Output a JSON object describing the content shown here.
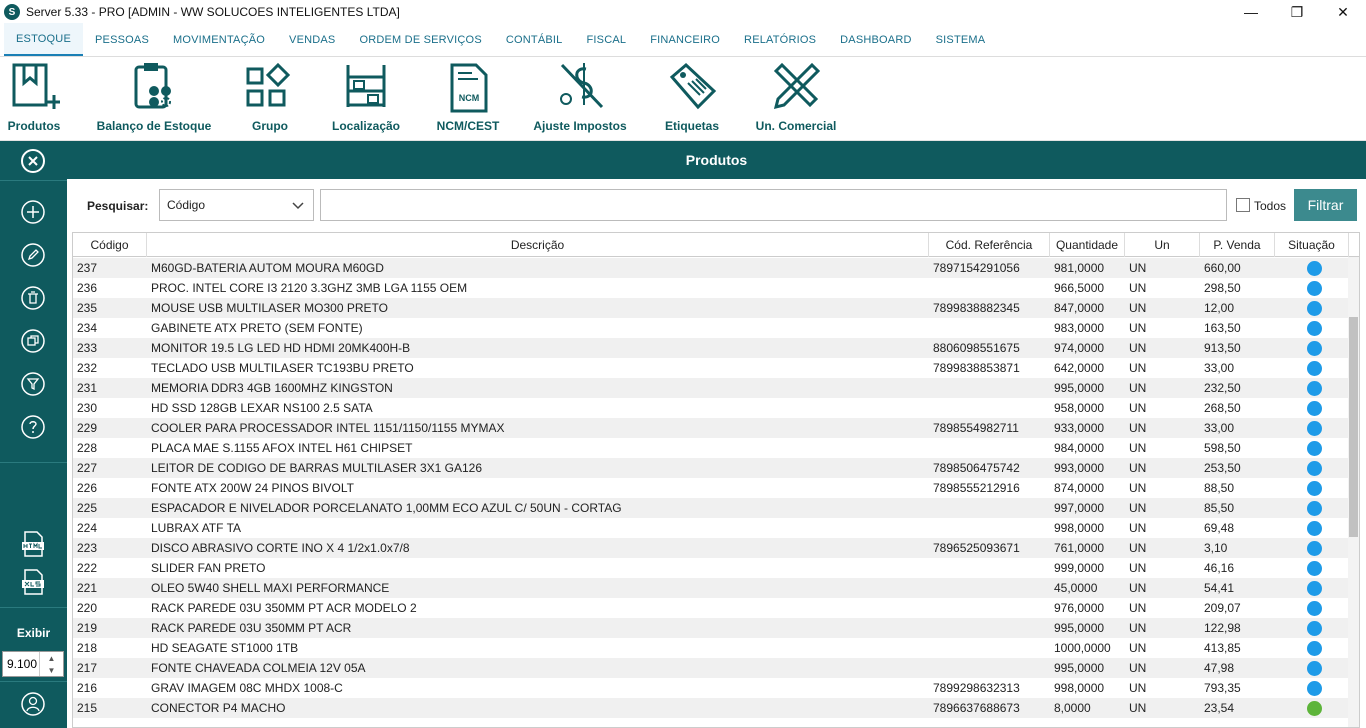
{
  "window": {
    "title": "Server 5.33 - PRO [ADMIN - WW SOLUCOES INTELIGENTES LTDA]",
    "logo_text": "S",
    "minimize": "—",
    "maximize": "❐",
    "close": "✕"
  },
  "menu": [
    "ESTOQUE",
    "PESSOAS",
    "MOVIMENTAÇÃO",
    "VENDAS",
    "ORDEM DE SERVIÇOS",
    "CONTÁBIL",
    "FISCAL",
    "FINANCEIRO",
    "RELATÓRIOS",
    "DASHBOARD",
    "SISTEMA"
  ],
  "ribbon": [
    "Produtos",
    "Balanço de Estoque",
    "Grupo",
    "Localização",
    "NCM/CEST",
    "Ajuste Impostos",
    "Etiquetas",
    "Un. Comercial"
  ],
  "ncm_icon_text": "NCM",
  "sidebar": {
    "exibir_label": "Exibir",
    "page_size": "9.100"
  },
  "page_title": "Produtos",
  "search": {
    "label": "Pesquisar:",
    "field": "Código",
    "query": "",
    "todos_label": "Todos",
    "filter_label": "Filtrar"
  },
  "colors": {
    "primary": "#0f5a5e",
    "accent_link": "#1a6f8a",
    "status_active": "#1e9be8",
    "status_other": "#5db43a"
  },
  "columns": [
    "Código",
    "Descrição",
    "Cód. Referência",
    "Quantidade",
    "Un",
    "P. Venda",
    "Situação"
  ],
  "rows": [
    [
      "237",
      "M60GD-BATERIA AUTOM MOURA M60GD",
      "7897154291056",
      "981,0000",
      "UN",
      "660,00",
      "blue"
    ],
    [
      "236",
      "PROC. INTEL CORE I3 2120 3.3GHZ 3MB LGA 1155 OEM",
      "",
      "966,5000",
      "UN",
      "298,50",
      "blue"
    ],
    [
      "235",
      "MOUSE USB MULTILASER MO300 PRETO",
      "7899838882345",
      "847,0000",
      "UN",
      "12,00",
      "blue"
    ],
    [
      "234",
      "GABINETE ATX PRETO (SEM FONTE)",
      "",
      "983,0000",
      "UN",
      "163,50",
      "blue"
    ],
    [
      "233",
      "MONITOR 19.5 LG LED HD HDMI 20MK400H-B",
      "8806098551675",
      "974,0000",
      "UN",
      "913,50",
      "blue"
    ],
    [
      "232",
      "TECLADO USB MULTILASER TC193BU PRETO",
      "7899838853871",
      "642,0000",
      "UN",
      "33,00",
      "blue"
    ],
    [
      "231",
      "MEMORIA DDR3 4GB 1600MHZ KINGSTON",
      "",
      "995,0000",
      "UN",
      "232,50",
      "blue"
    ],
    [
      "230",
      "HD SSD 128GB LEXAR NS100 2.5 SATA",
      "",
      "958,0000",
      "UN",
      "268,50",
      "blue"
    ],
    [
      "229",
      "COOLER PARA PROCESSADOR INTEL 1151/1150/1155 MYMAX",
      "7898554982711",
      "933,0000",
      "UN",
      "33,00",
      "blue"
    ],
    [
      "228",
      "PLACA MAE S.1155 AFOX INTEL H61 CHIPSET",
      "",
      "984,0000",
      "UN",
      "598,50",
      "blue"
    ],
    [
      "227",
      "LEITOR DE CODIGO DE BARRAS MULTILASER 3X1 GA126",
      "7898506475742",
      "993,0000",
      "UN",
      "253,50",
      "blue"
    ],
    [
      "226",
      "FONTE ATX 200W 24 PINOS BIVOLT",
      "7898555212916",
      "874,0000",
      "UN",
      "88,50",
      "blue"
    ],
    [
      "225",
      "ESPACADOR E NIVELADOR PORCELANATO 1,00MM ECO AZUL C/ 50UN - CORTAG",
      "",
      "997,0000",
      "UN",
      "85,50",
      "blue"
    ],
    [
      "224",
      "LUBRAX ATF TA",
      "",
      "998,0000",
      "UN",
      "69,48",
      "blue"
    ],
    [
      "223",
      "DISCO ABRASIVO CORTE INO X 4 1/2x1.0x7/8",
      "7896525093671",
      "761,0000",
      "UN",
      "3,10",
      "blue"
    ],
    [
      "222",
      "SLIDER FAN PRETO",
      "",
      "999,0000",
      "UN",
      "46,16",
      "blue"
    ],
    [
      "221",
      "OLEO 5W40 SHELL MAXI PERFORMANCE",
      "",
      "45,0000",
      "UN",
      "54,41",
      "blue"
    ],
    [
      "220",
      "RACK PAREDE 03U 350MM PT ACR MODELO 2",
      "",
      "976,0000",
      "UN",
      "209,07",
      "blue"
    ],
    [
      "219",
      "RACK PAREDE 03U 350MM PT ACR",
      "",
      "995,0000",
      "UN",
      "122,98",
      "blue"
    ],
    [
      "218",
      "HD SEAGATE ST1000 1TB",
      "",
      "1000,0000",
      "UN",
      "413,85",
      "blue"
    ],
    [
      "217",
      "FONTE CHAVEADA COLMEIA 12V 05A",
      "",
      "995,0000",
      "UN",
      "47,98",
      "blue"
    ],
    [
      "216",
      "GRAV IMAGEM 08C MHDX 1008-C",
      "7899298632313",
      "998,0000",
      "UN",
      "793,35",
      "blue"
    ],
    [
      "215",
      "CONECTOR P4 MACHO",
      "7896637688673",
      "8,0000",
      "UN",
      "23,54",
      "green"
    ]
  ]
}
